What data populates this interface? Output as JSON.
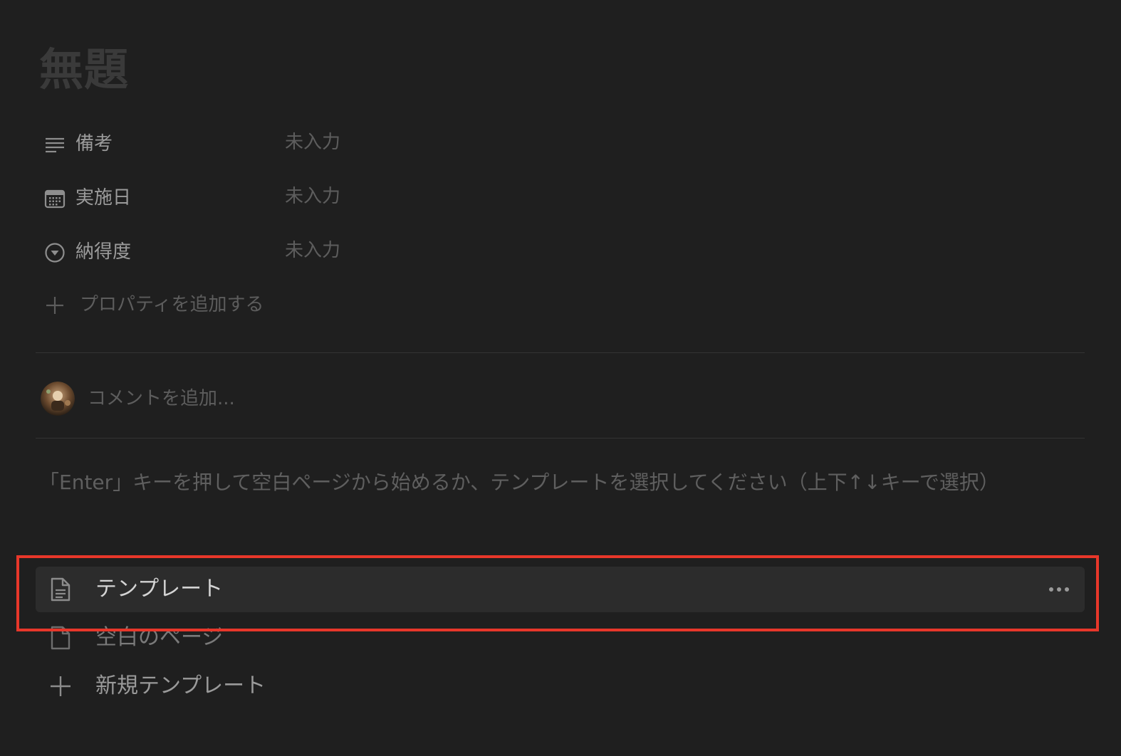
{
  "page": {
    "title": "無題"
  },
  "properties": [
    {
      "icon": "text-lines-icon",
      "label": "備考",
      "value": "未入力"
    },
    {
      "icon": "calendar-icon",
      "label": "実施日",
      "value": "未入力"
    },
    {
      "icon": "select-circle-icon",
      "label": "納得度",
      "value": "未入力"
    }
  ],
  "add_property": {
    "icon": "plus-icon",
    "label": "プロパティを追加する"
  },
  "comment": {
    "placeholder": "コメントを追加..."
  },
  "hint": {
    "text": "「Enter」キーを押して空白ページから始めるか、テンプレートを選択してください（上下↑↓キーで選択）"
  },
  "templates": [
    {
      "icon": "document-icon",
      "label": "テンプレート",
      "selected": true
    },
    {
      "icon": "blank-page-icon",
      "label": "空白のページ",
      "selected": false
    },
    {
      "icon": "plus-icon",
      "label": "新規テンプレート",
      "selected": false
    }
  ],
  "colors": {
    "background": "#1f1f1f",
    "highlight_border": "#e8372a",
    "selected_row": "#2c2c2c"
  }
}
